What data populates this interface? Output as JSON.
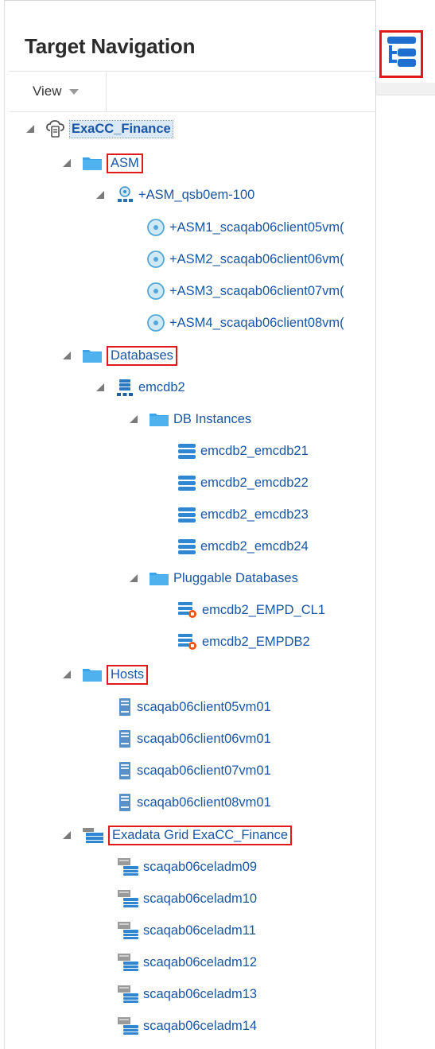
{
  "panel": {
    "title": "Target Navigation",
    "view_label": "View"
  },
  "icons": {
    "collapse": "panel-collapse-icon",
    "folder": "folder-icon",
    "cloud": "cloud-target-icon",
    "asm": "asm-cluster-icon",
    "asm_instance": "asm-instance-icon",
    "database": "database-icon",
    "db_instance": "db-instance-icon",
    "pdb": "pluggable-database-icon",
    "host": "host-icon",
    "exadata": "exadata-grid-icon",
    "cell": "storage-cell-icon"
  },
  "colors": {
    "link": "#1a56a3",
    "highlight_box": "#e01a1a",
    "folder_blue": "#3ba3e6",
    "selected_bg": "#dbe9f7"
  },
  "tree": {
    "root": "ExaCC_Finance",
    "asm_group": "ASM",
    "asm_cluster": "+ASM_qsb0em-100",
    "asm_instances": [
      "+ASM1_scaqab06client05vm(",
      "+ASM2_scaqab06client06vm(",
      "+ASM3_scaqab06client07vm(",
      "+ASM4_scaqab06client08vm("
    ],
    "databases_group": "Databases",
    "database": "emcdb2",
    "db_instances_group": "DB Instances",
    "db_instances": [
      "emcdb2_emcdb21",
      "emcdb2_emcdb22",
      "emcdb2_emcdb23",
      "emcdb2_emcdb24"
    ],
    "pdb_group": "Pluggable Databases",
    "pdbs": [
      "emcdb2_EMPD_CL1",
      "emcdb2_EMPDB2"
    ],
    "hosts_group": "Hosts",
    "hosts": [
      "scaqab06client05vm01",
      "scaqab06client06vm01",
      "scaqab06client07vm01",
      "scaqab06client08vm01"
    ],
    "exadata_group": "Exadata Grid ExaCC_Finance",
    "cells": [
      "scaqab06celadm09",
      "scaqab06celadm10",
      "scaqab06celadm11",
      "scaqab06celadm12",
      "scaqab06celadm13",
      "scaqab06celadm14"
    ]
  }
}
